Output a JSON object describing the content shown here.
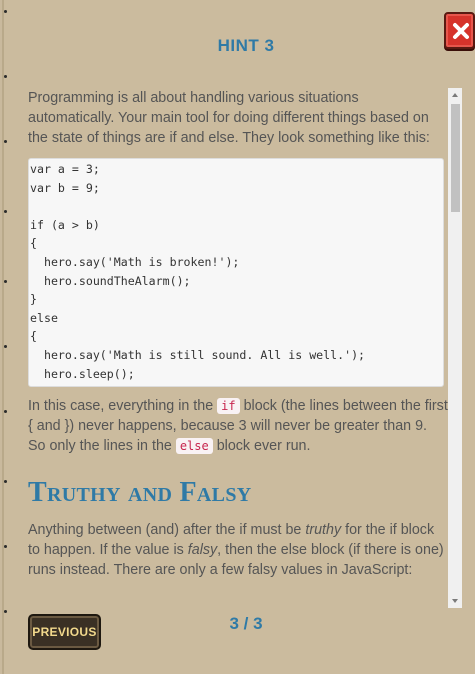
{
  "modal": {
    "title": "HINT 3",
    "close_icon": "close-x-icon",
    "page_indicator": "3 / 3",
    "previous_label": "PREVIOUS"
  },
  "content": {
    "paragraph1": "Programming is all about handling various situations automatically. Your main tool for doing different things based on the state of things are if and else. They look something like this:",
    "code_block": "var a = 3;\nvar b = 9;\n\nif (a > b)\n{\n  hero.say('Math is broken!');\n  hero.soundTheAlarm();\n}\nelse\n{\n  hero.say('Math is still sound. All is well.');\n  hero.sleep();\n}",
    "paragraph2_a": "In this case, everything in the ",
    "paragraph2_code1": "if",
    "paragraph2_b": " block (the lines between the first { and }) never happens, because 3 will never be greater than 9. So only the lines in the ",
    "paragraph2_code2": "else",
    "paragraph2_c": " block ever run.",
    "section_heading": "Truthy and Falsy",
    "paragraph3_a": "Anything between (and) after the if must be ",
    "paragraph3_em1": "truthy",
    "paragraph3_b": " for the if block to happen. If the value is ",
    "paragraph3_em2": "falsy",
    "paragraph3_c": ", then the else block (if there is one) runs instead. There are only a few falsy values in JavaScript:"
  },
  "colors": {
    "background": "#cbbb9e",
    "accent_blue": "#2f7aa6",
    "close_red": "#d6332b",
    "button_dark": "#3a3024",
    "button_text": "#f2d98c"
  }
}
